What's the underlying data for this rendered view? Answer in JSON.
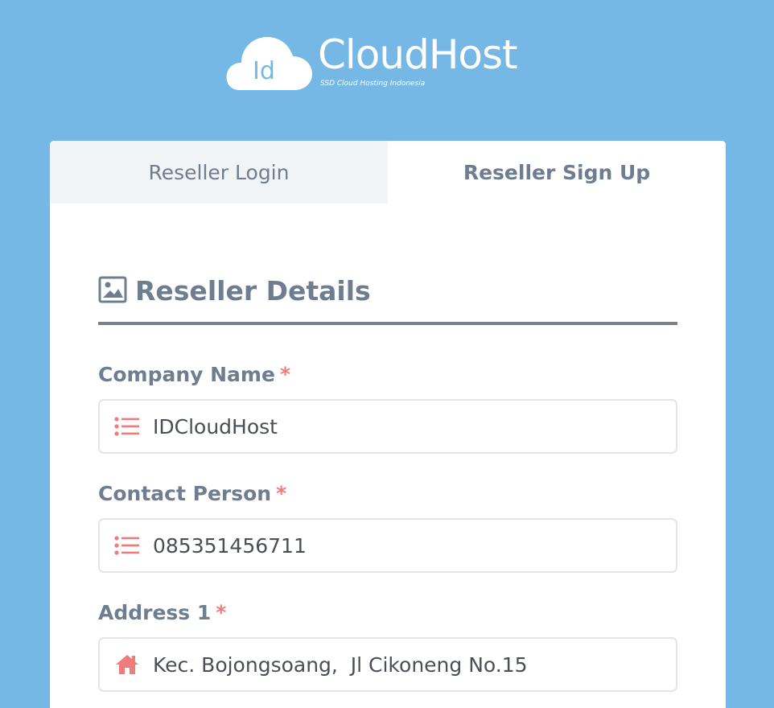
{
  "logo": {
    "badge": "Id",
    "name": "CloudHost",
    "tagline": "SSD Cloud Hosting Indonesia"
  },
  "tabs": [
    {
      "label": "Reseller Login",
      "active": false
    },
    {
      "label": "Reseller Sign Up",
      "active": true
    }
  ],
  "section": {
    "title": "Reseller Details",
    "icon": "image-icon"
  },
  "fields": [
    {
      "label": "Company Name",
      "required_mark": "*",
      "value": "IDCloudHost",
      "icon": "list-icon"
    },
    {
      "label": "Contact Person",
      "required_mark": "*",
      "value": "085351456711",
      "icon": "list-icon"
    },
    {
      "label": "Address 1",
      "required_mark": "*",
      "value": "Kec. Bojongsoang,  Jl Cikoneng No.15",
      "icon": "home-icon"
    }
  ],
  "colors": {
    "background": "#75b8e6",
    "accent": "#ef7b7b",
    "label": "#6f7d90",
    "tab_inactive_bg": "#f1f4f6"
  }
}
